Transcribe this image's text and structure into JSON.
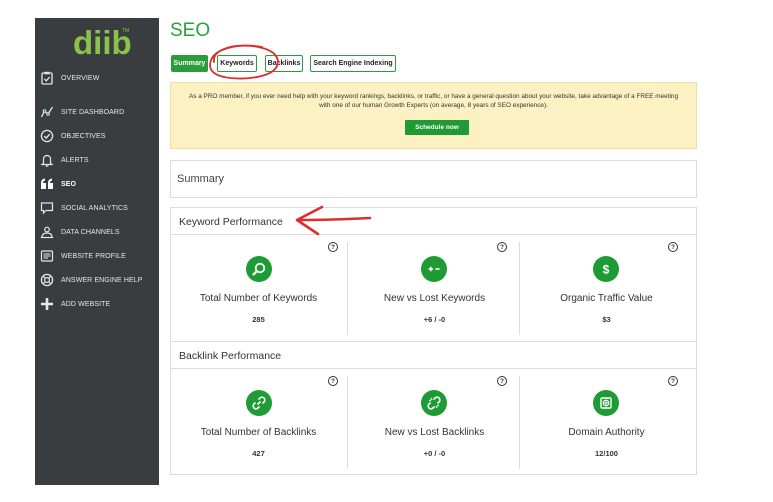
{
  "app": {
    "logo_text": "diib",
    "trademark": "TM"
  },
  "sidebar": {
    "items": [
      {
        "label": "OVERVIEW",
        "icon": "clipboard-check-icon"
      },
      {
        "label": "SITE DASHBOARD",
        "icon": "line-chart-icon"
      },
      {
        "label": "OBJECTIVES",
        "icon": "check-circle-icon"
      },
      {
        "label": "ALERTS",
        "icon": "bell-icon"
      },
      {
        "label": "SEO",
        "icon": "quote-icon"
      },
      {
        "label": "SOCIAL ANALYTICS",
        "icon": "chat-bubble-icon"
      },
      {
        "label": "DATA CHANNELS",
        "icon": "people-icon"
      },
      {
        "label": "WEBSITE PROFILE",
        "icon": "profile-card-icon"
      },
      {
        "label": "ANSWER ENGINE HELP",
        "icon": "lifebuoy-icon"
      },
      {
        "label": "ADD WEBSITE",
        "icon": "plus-icon"
      }
    ]
  },
  "page": {
    "title": "SEO"
  },
  "tabs": [
    {
      "label": "Summary",
      "active": true
    },
    {
      "label": "Keywords",
      "active": false
    },
    {
      "label": "Backlinks",
      "active": false
    },
    {
      "label": "Search Engine Indexing",
      "active": false
    }
  ],
  "banner": {
    "text": "As a PRO member, if you ever need help with your keyword rankings, backlinks, or traffic, or have a general question about your website, take advantage of a FREE meeting with one of our human Growth Experts (on average, 8 years of SEO experience).",
    "button_label": "Schedule now"
  },
  "summary": {
    "heading": "Summary"
  },
  "keyword_performance": {
    "heading": "Keyword Performance",
    "metrics": [
      {
        "label": "Total Number of Keywords",
        "value": "285",
        "icon": "search-icon"
      },
      {
        "label": "New vs Lost Keywords",
        "value": "+6 / -0",
        "icon": "plus-minus-icon"
      },
      {
        "label": "Organic Traffic Value",
        "value": "$3",
        "icon": "dollar-icon"
      }
    ]
  },
  "backlink_performance": {
    "heading": "Backlink Performance",
    "metrics": [
      {
        "label": "Total Number of Backlinks",
        "value": "427",
        "icon": "link-icon"
      },
      {
        "label": "New vs Lost Backlinks",
        "value": "+0 / -0",
        "icon": "broken-link-icon"
      },
      {
        "label": "Domain Authority",
        "value": "12/100",
        "icon": "domain-icon"
      }
    ]
  },
  "help_glyph": "?",
  "colors": {
    "brand_green": "#27a23a",
    "sidebar_bg": "#3a3d40",
    "banner_bg": "#fbf1c2",
    "annotation_red": "#d9302c"
  }
}
